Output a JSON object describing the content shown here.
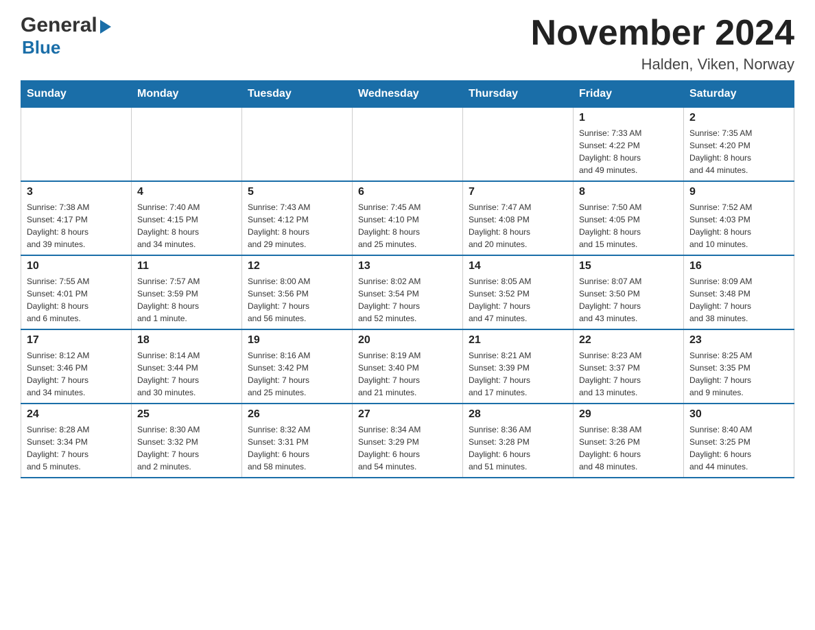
{
  "logo": {
    "general": "General",
    "blue": "Blue",
    "arrow": "▶"
  },
  "title": "November 2024",
  "location": "Halden, Viken, Norway",
  "weekdays": [
    "Sunday",
    "Monday",
    "Tuesday",
    "Wednesday",
    "Thursday",
    "Friday",
    "Saturday"
  ],
  "weeks": [
    [
      {
        "day": "",
        "info": ""
      },
      {
        "day": "",
        "info": ""
      },
      {
        "day": "",
        "info": ""
      },
      {
        "day": "",
        "info": ""
      },
      {
        "day": "",
        "info": ""
      },
      {
        "day": "1",
        "info": "Sunrise: 7:33 AM\nSunset: 4:22 PM\nDaylight: 8 hours\nand 49 minutes."
      },
      {
        "day": "2",
        "info": "Sunrise: 7:35 AM\nSunset: 4:20 PM\nDaylight: 8 hours\nand 44 minutes."
      }
    ],
    [
      {
        "day": "3",
        "info": "Sunrise: 7:38 AM\nSunset: 4:17 PM\nDaylight: 8 hours\nand 39 minutes."
      },
      {
        "day": "4",
        "info": "Sunrise: 7:40 AM\nSunset: 4:15 PM\nDaylight: 8 hours\nand 34 minutes."
      },
      {
        "day": "5",
        "info": "Sunrise: 7:43 AM\nSunset: 4:12 PM\nDaylight: 8 hours\nand 29 minutes."
      },
      {
        "day": "6",
        "info": "Sunrise: 7:45 AM\nSunset: 4:10 PM\nDaylight: 8 hours\nand 25 minutes."
      },
      {
        "day": "7",
        "info": "Sunrise: 7:47 AM\nSunset: 4:08 PM\nDaylight: 8 hours\nand 20 minutes."
      },
      {
        "day": "8",
        "info": "Sunrise: 7:50 AM\nSunset: 4:05 PM\nDaylight: 8 hours\nand 15 minutes."
      },
      {
        "day": "9",
        "info": "Sunrise: 7:52 AM\nSunset: 4:03 PM\nDaylight: 8 hours\nand 10 minutes."
      }
    ],
    [
      {
        "day": "10",
        "info": "Sunrise: 7:55 AM\nSunset: 4:01 PM\nDaylight: 8 hours\nand 6 minutes."
      },
      {
        "day": "11",
        "info": "Sunrise: 7:57 AM\nSunset: 3:59 PM\nDaylight: 8 hours\nand 1 minute."
      },
      {
        "day": "12",
        "info": "Sunrise: 8:00 AM\nSunset: 3:56 PM\nDaylight: 7 hours\nand 56 minutes."
      },
      {
        "day": "13",
        "info": "Sunrise: 8:02 AM\nSunset: 3:54 PM\nDaylight: 7 hours\nand 52 minutes."
      },
      {
        "day": "14",
        "info": "Sunrise: 8:05 AM\nSunset: 3:52 PM\nDaylight: 7 hours\nand 47 minutes."
      },
      {
        "day": "15",
        "info": "Sunrise: 8:07 AM\nSunset: 3:50 PM\nDaylight: 7 hours\nand 43 minutes."
      },
      {
        "day": "16",
        "info": "Sunrise: 8:09 AM\nSunset: 3:48 PM\nDaylight: 7 hours\nand 38 minutes."
      }
    ],
    [
      {
        "day": "17",
        "info": "Sunrise: 8:12 AM\nSunset: 3:46 PM\nDaylight: 7 hours\nand 34 minutes."
      },
      {
        "day": "18",
        "info": "Sunrise: 8:14 AM\nSunset: 3:44 PM\nDaylight: 7 hours\nand 30 minutes."
      },
      {
        "day": "19",
        "info": "Sunrise: 8:16 AM\nSunset: 3:42 PM\nDaylight: 7 hours\nand 25 minutes."
      },
      {
        "day": "20",
        "info": "Sunrise: 8:19 AM\nSunset: 3:40 PM\nDaylight: 7 hours\nand 21 minutes."
      },
      {
        "day": "21",
        "info": "Sunrise: 8:21 AM\nSunset: 3:39 PM\nDaylight: 7 hours\nand 17 minutes."
      },
      {
        "day": "22",
        "info": "Sunrise: 8:23 AM\nSunset: 3:37 PM\nDaylight: 7 hours\nand 13 minutes."
      },
      {
        "day": "23",
        "info": "Sunrise: 8:25 AM\nSunset: 3:35 PM\nDaylight: 7 hours\nand 9 minutes."
      }
    ],
    [
      {
        "day": "24",
        "info": "Sunrise: 8:28 AM\nSunset: 3:34 PM\nDaylight: 7 hours\nand 5 minutes."
      },
      {
        "day": "25",
        "info": "Sunrise: 8:30 AM\nSunset: 3:32 PM\nDaylight: 7 hours\nand 2 minutes."
      },
      {
        "day": "26",
        "info": "Sunrise: 8:32 AM\nSunset: 3:31 PM\nDaylight: 6 hours\nand 58 minutes."
      },
      {
        "day": "27",
        "info": "Sunrise: 8:34 AM\nSunset: 3:29 PM\nDaylight: 6 hours\nand 54 minutes."
      },
      {
        "day": "28",
        "info": "Sunrise: 8:36 AM\nSunset: 3:28 PM\nDaylight: 6 hours\nand 51 minutes."
      },
      {
        "day": "29",
        "info": "Sunrise: 8:38 AM\nSunset: 3:26 PM\nDaylight: 6 hours\nand 48 minutes."
      },
      {
        "day": "30",
        "info": "Sunrise: 8:40 AM\nSunset: 3:25 PM\nDaylight: 6 hours\nand 44 minutes."
      }
    ]
  ]
}
